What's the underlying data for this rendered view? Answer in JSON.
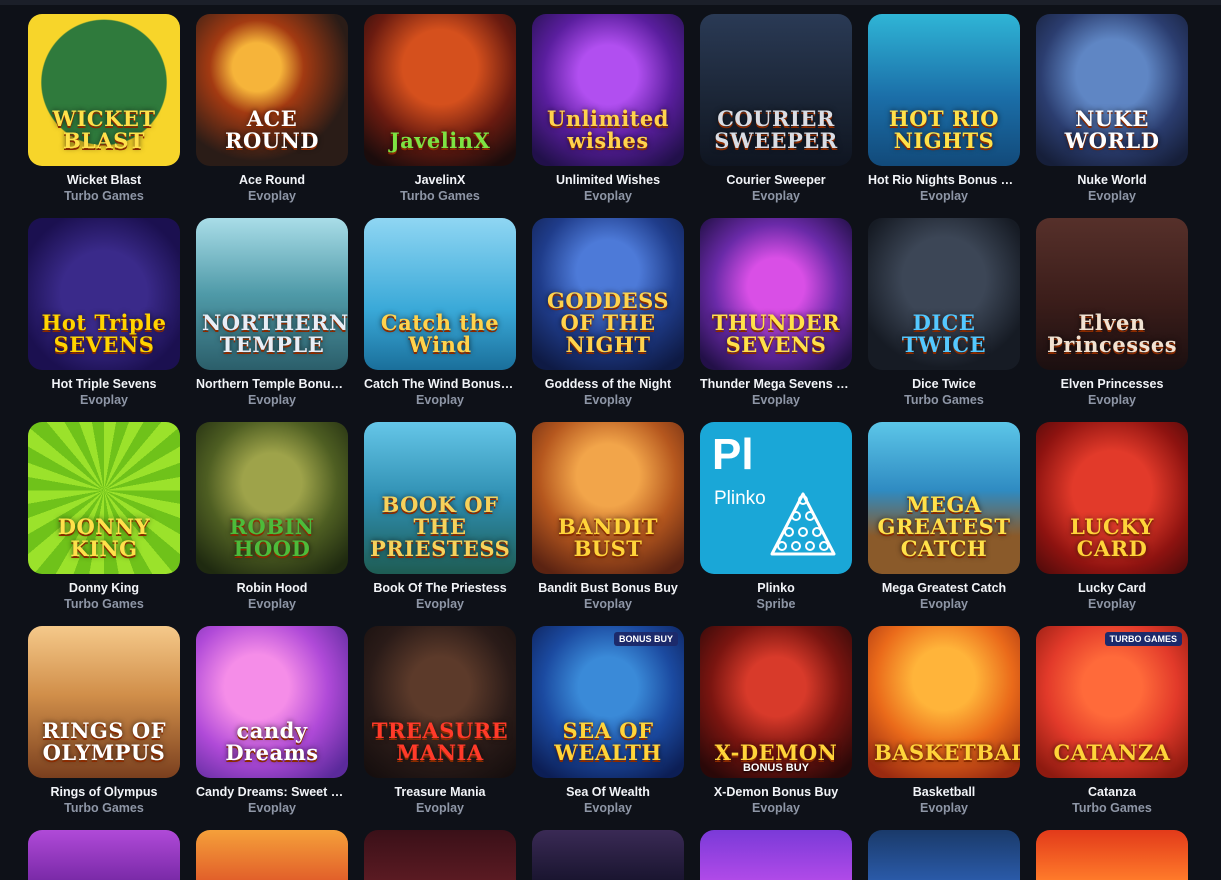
{
  "games": [
    {
      "title": "Wicket Blast",
      "provider": "Turbo Games",
      "thumb_text": "WICKET BLAST",
      "bg": "radial-gradient(circle at 50% 45%, #2f7a3c 0 55%, #f7d52a 56%)",
      "fg": "#ffe14a"
    },
    {
      "title": "Ace Round",
      "provider": "Evoplay",
      "thumb_text": "ACE ROUND",
      "bg": "radial-gradient(circle at 40% 35%, #f6b43a 0 18%, #a33a12 35%, #2a1c17 70%)",
      "fg": "#ffffff"
    },
    {
      "title": "JavelinX",
      "provider": "Turbo Games",
      "thumb_text": "JavelinX",
      "bg": "radial-gradient(circle at 50% 35%, #d5501d 0 30%, #6a1b10 60%, #1b0c0c 90%)",
      "fg": "#7de343"
    },
    {
      "title": "Unlimited Wishes",
      "provider": "Evoplay",
      "thumb_text": "Unlimited wishes",
      "bg": "radial-gradient(circle at 50% 40%, #b14ff0 0 25%, #5a1e9e 55%, #21104a 90%)",
      "fg": "#ffd34d"
    },
    {
      "title": "Courier Sweeper",
      "provider": "Evoplay",
      "thumb_text": "COURIER SWEEPER",
      "bg": "linear-gradient(180deg,#2a3a55,#1a2434 60%,#0f1521)",
      "fg": "#d9dde5"
    },
    {
      "title": "Hot Rio Nights Bonus Buy",
      "provider": "Evoplay",
      "thumb_text": "HOT RIO NIGHTS",
      "bg": "linear-gradient(180deg,#2fb5d6,#1b6ea8 55%,#124a7a)",
      "fg": "#ffe14a"
    },
    {
      "title": "Nuke World",
      "provider": "Evoplay",
      "thumb_text": "NUKE WORLD",
      "bg": "radial-gradient(circle at 50% 40%, #5f86c4 0 30%, #2b3d6f 60%, #161f3a 90%)",
      "fg": "#ffffff"
    },
    {
      "title": "Hot Triple Sevens",
      "provider": "Evoplay",
      "thumb_text": "Hot Triple SEVENS",
      "bg": "radial-gradient(circle at 50% 50%, #3a2a8a 0 40%, #1b1050 80%)",
      "fg": "#ffd400"
    },
    {
      "title": "Northern Temple Bonus Buy",
      "provider": "Evoplay",
      "thumb_text": "NORTHERN TEMPLE",
      "bg": "linear-gradient(180deg,#a9dde8,#4f9aa8 50%,#2b5e6a)",
      "fg": "#e8eef7"
    },
    {
      "title": "Catch The Wind Bonus Buy",
      "provider": "Evoplay",
      "thumb_text": "Catch the Wind",
      "bg": "linear-gradient(180deg,#8fd6f3,#3aa9d8 60%,#1a6f9b)",
      "fg": "#ffd34d"
    },
    {
      "title": "Goddess of the Night",
      "provider": "Evoplay",
      "thumb_text": "GODDESS OF THE NIGHT",
      "bg": "radial-gradient(circle at 50% 35%, #4d7ad8 0 25%, #1f3c8a 55%, #0e1a44 90%)",
      "fg": "#ffd34d"
    },
    {
      "title": "Thunder Mega Sevens Bonus Buy",
      "provider": "Evoplay",
      "thumb_text": "THUNDER SEVENS",
      "bg": "radial-gradient(circle at 50% 45%, #d94fe6 0 25%, #6a2aa8 55%, #231048 90%)",
      "fg": "#ffe14a"
    },
    {
      "title": "Dice Twice",
      "provider": "Turbo Games",
      "thumb_text": "DICE TWICE",
      "bg": "radial-gradient(circle at 50% 40%, #3c4656 0 35%, #161b24 75%)",
      "fg": "#54c8ff"
    },
    {
      "title": "Elven Princesses",
      "provider": "Evoplay",
      "thumb_text": "Elven Princesses",
      "bg": "linear-gradient(180deg,#56302a,#3b1d1a 55%,#1b0f10)",
      "fg": "#f1e2d2"
    },
    {
      "title": "Donny King",
      "provider": "Turbo Games",
      "thumb_text": "DONNY KING",
      "bg": "repeating-conic-gradient(from 0deg at 50% 45%, #9be22b 0 10deg, #6fc21a 10deg 20deg)",
      "fg": "#ffe14a"
    },
    {
      "title": "Robin Hood",
      "provider": "Evoplay",
      "thumb_text": "ROBIN HOOD",
      "bg": "radial-gradient(circle at 50% 40%, #9ea34a 0 25%, #4e5e22 55%, #1f2a10 90%)",
      "fg": "#4dbb3a"
    },
    {
      "title": "Book Of The Priestess",
      "provider": "Evoplay",
      "thumb_text": "BOOK OF THE PRIESTESS",
      "bg": "linear-gradient(180deg,#65c6e8,#2f8fb2 50%,#1e5c53)",
      "fg": "#f6d25c"
    },
    {
      "title": "Bandit Bust Bonus Buy",
      "provider": "Evoplay",
      "thumb_text": "BANDIT BUST",
      "bg": "radial-gradient(circle at 50% 35%, #f2a54a 0 25%, #b5571e 55%, #5b2312 90%)",
      "fg": "#ffd43a"
    },
    {
      "title": "Plinko",
      "provider": "Spribe",
      "thumb_text": "Plinko",
      "bg": "#1aa7d7",
      "fg": "#ffffff"
    },
    {
      "title": "Mega Greatest Catch",
      "provider": "Evoplay",
      "thumb_text": "MEGA GREATEST CATCH",
      "bg": "linear-gradient(180deg,#5cc6e8,#2f8bc2 45%,#8a5a2a 75%)",
      "fg": "#ffe14a"
    },
    {
      "title": "Lucky Card",
      "provider": "Evoplay",
      "thumb_text": "LUCKY CARD",
      "bg": "radial-gradient(circle at 50% 45%, #e23a2a 0 35%, #8e1310 70%, #4a0a0a)",
      "fg": "#ffd43a"
    },
    {
      "title": "Rings of Olympus",
      "provider": "Turbo Games",
      "thumb_text": "RINGS OF OLYMPUS",
      "bg": "linear-gradient(180deg,#f5c98a,#d18f4a 45%,#7a3f1e)",
      "fg": "#ffffff"
    },
    {
      "title": "Candy Dreams: Sweet Planet",
      "provider": "Evoplay",
      "thumb_text": "candy Dreams",
      "bg": "radial-gradient(circle at 40% 40%, #f58de8 0 25%, #b04ad8 55%, #5b2a9b 90%)",
      "fg": "#ffffff"
    },
    {
      "title": "Treasure Mania",
      "provider": "Evoplay",
      "thumb_text": "TREASURE MANIA",
      "bg": "radial-gradient(circle at 50% 40%, #5c3a2a 0 25%, #2a1b18 60%, #120c0c)",
      "fg": "#ff3a2a"
    },
    {
      "title": "Sea Of Wealth",
      "provider": "Evoplay",
      "thumb_text": "SEA OF WEALTH",
      "bg": "radial-gradient(circle at 50% 40%, #3a8ad8 0 25%, #1b4aa0 55%, #0c1e55 90%)",
      "fg": "#ffd43a",
      "badge": "BONUS BUY"
    },
    {
      "title": "X-Demon Bonus Buy",
      "provider": "Evoplay",
      "thumb_text": "X-DEMON",
      "bg": "radial-gradient(circle at 50% 40%, #d83a2a 0 25%, #7a1510 55%, #2a0808 90%)",
      "fg": "#ffd43a",
      "tag": "BONUS BUY"
    },
    {
      "title": "Basketball",
      "provider": "Evoplay",
      "thumb_text": "BASKETBALL",
      "bg": "radial-gradient(circle at 50% 35%, #ffb43a 0 25%, #ea6a1a 55%, #9a2a10 90%)",
      "fg": "#ffd43a"
    },
    {
      "title": "Catanza",
      "provider": "Turbo Games",
      "thumb_text": "CATANZA",
      "bg": "radial-gradient(circle at 50% 40%, #ff6a3a 0 25%, #e23a2a 55%, #8e1a10 90%)",
      "fg": "#ffd43a",
      "badge": "TURBO GAMES"
    }
  ],
  "partial_row": [
    {
      "bg": "linear-gradient(180deg,#b04ad8,#7a2aa8)"
    },
    {
      "bg": "linear-gradient(180deg,#f5a03a,#e2602a)"
    },
    {
      "bg": "linear-gradient(180deg,#3a1018,#5a1a22)"
    },
    {
      "bg": "linear-gradient(180deg,#3a2a55,#1a1530)"
    },
    {
      "bg": "linear-gradient(180deg,#7a3ad8,#b04ae8)"
    },
    {
      "bg": "linear-gradient(180deg,#1a3a6a,#2a5aa8)"
    },
    {
      "bg": "linear-gradient(180deg,#e23a1a,#ff7a2a)"
    }
  ]
}
